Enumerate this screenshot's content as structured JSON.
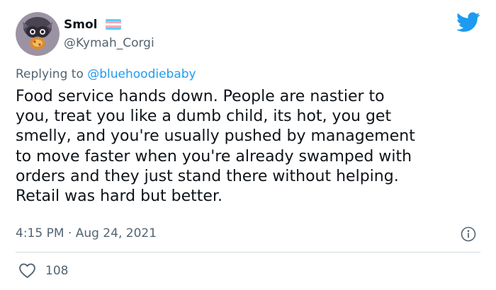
{
  "author": {
    "display_name": "Smol",
    "handle": "@Kymah_Corgi",
    "flag_colors": [
      "#5bcefa",
      "#f5a9b8",
      "#ffffff",
      "#f5a9b8",
      "#5bcefa"
    ]
  },
  "reply": {
    "prefix": "Replying to ",
    "mention": "@bluehoodiebaby"
  },
  "tweet": {
    "text": "Food service hands down. People are nastier to\nyou, treat you like a dumb child, its hot, you get\nsmelly, and you're usually pushed by management\nto move faster when you're already swamped with\norders and they just stand there without helping.\nRetail was hard but better."
  },
  "meta": {
    "timestamp": "4:15 PM · Aug 24, 2021"
  },
  "actions": {
    "like_count": "108"
  },
  "icons": {
    "brand": "twitter-bird-icon",
    "info": "info-icon",
    "like": "heart-icon"
  },
  "colors": {
    "accent": "#1d9bf0",
    "text": "#0f1419",
    "muted": "#536471",
    "divider": "#cfd9de"
  }
}
